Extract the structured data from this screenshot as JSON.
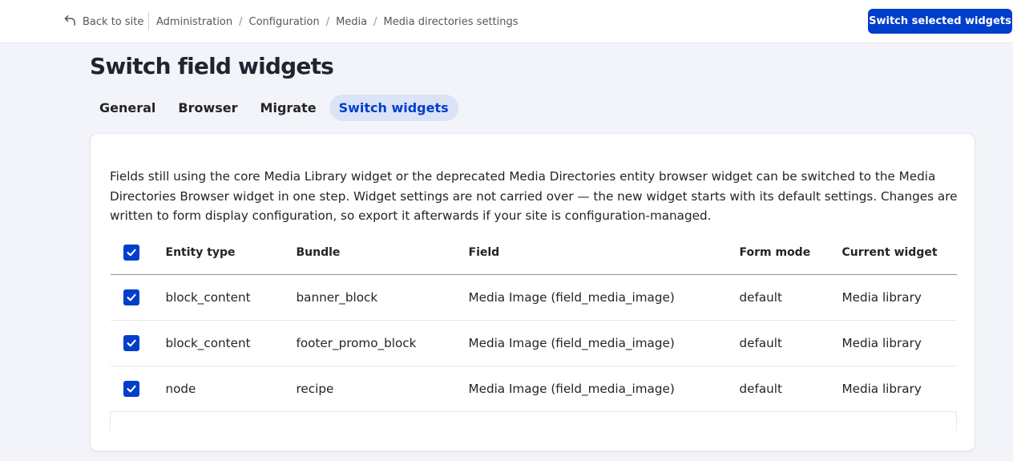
{
  "topbar": {
    "back_label": "Back to site",
    "breadcrumb": [
      "Administration",
      "Configuration",
      "Media",
      "Media directories settings"
    ],
    "primary_button": "Switch selected widgets"
  },
  "page": {
    "title": "Switch field widgets",
    "tabs": [
      {
        "label": "General",
        "active": false
      },
      {
        "label": "Browser",
        "active": false
      },
      {
        "label": "Migrate",
        "active": false
      },
      {
        "label": "Switch widgets",
        "active": true
      }
    ]
  },
  "card": {
    "description": "Fields still using the core Media Library widget or the deprecated Media Directories entity browser widget can be switched to the Media Directories Browser widget in one step. Widget settings are not carried over — the new widget starts with its default settings. Changes are written to form display configuration, so export it afterwards if your site is configuration-managed."
  },
  "table": {
    "select_all_checked": true,
    "headers": {
      "entity_type": "Entity type",
      "bundle": "Bundle",
      "field": "Field",
      "form_mode": "Form mode",
      "current_widget": "Current widget"
    },
    "rows": [
      {
        "checked": true,
        "entity_type": "block_content",
        "bundle": "banner_block",
        "field": "Media Image (field_media_image)",
        "form_mode": "default",
        "current_widget": "Media library"
      },
      {
        "checked": true,
        "entity_type": "block_content",
        "bundle": "footer_promo_block",
        "field": "Media Image (field_media_image)",
        "form_mode": "default",
        "current_widget": "Media library"
      },
      {
        "checked": true,
        "entity_type": "node",
        "bundle": "recipe",
        "field": "Media Image (field_media_image)",
        "form_mode": "default",
        "current_widget": "Media library"
      }
    ]
  },
  "colors": {
    "accent": "#003ecc",
    "active_tab_bg": "#dbe3f6",
    "page_bg": "#f3f4f9"
  },
  "icons": {
    "back": "back-arrow-icon",
    "checkbox": "checkmark-icon"
  }
}
